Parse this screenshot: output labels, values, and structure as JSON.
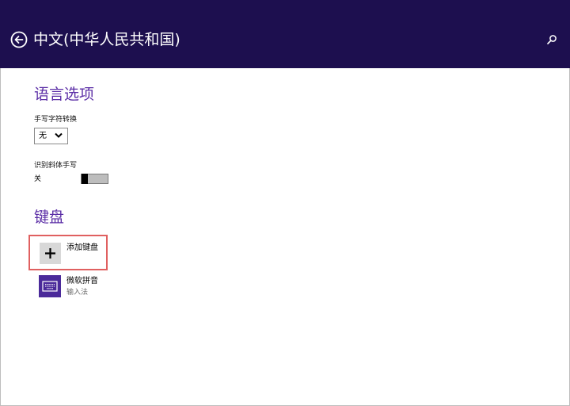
{
  "header": {
    "title": "中文(中华人民共和国)",
    "icons": {
      "back": "back-arrow-icon",
      "search": "search-icon"
    },
    "colors": {
      "background": "#1d0f4f",
      "text": "#ffffff"
    }
  },
  "language_options": {
    "section_title": "语言选项",
    "handwriting_conversion": {
      "label": "手写字符转换",
      "selected_value": "无"
    },
    "italic_recognition": {
      "label": "识别斜体手写",
      "state_text": "关",
      "toggle_on": false
    }
  },
  "keyboards": {
    "section_title": "键盘",
    "add_keyboard": {
      "label": "添加键盘",
      "icon": "plus-icon"
    },
    "items": [
      {
        "name": "微软拼音",
        "type": "输入法",
        "icon": "keyboard-icon"
      }
    ]
  },
  "colors": {
    "accent": "#5b2ea6",
    "keyboard_tile": "#4b2a9a",
    "highlight_border": "#e06060"
  }
}
